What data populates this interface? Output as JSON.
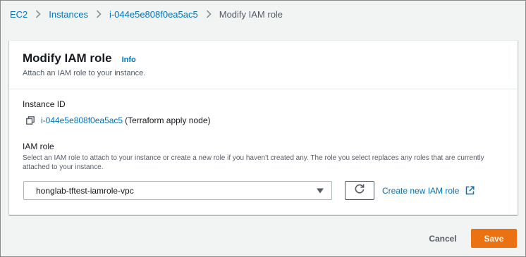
{
  "breadcrumb": {
    "items": [
      {
        "label": "EC2"
      },
      {
        "label": "Instances"
      },
      {
        "label": "i-044e5e808f0ea5ac5"
      },
      {
        "label": "Modify IAM role"
      }
    ]
  },
  "card": {
    "title": "Modify IAM role",
    "info_label": "Info",
    "description": "Attach an IAM role to your instance.",
    "instance_id_label": "Instance ID",
    "instance_id": "i-044e5e808f0ea5ac5",
    "instance_name": "(Terraform apply node)",
    "iam_role_label": "IAM role",
    "iam_role_description": "Select an IAM role to attach to your instance or create a new role if you haven't created any. The role you select replaces any roles that are currently attached to your instance.",
    "selected_role": "honglab-tftest-iamrole-vpc",
    "create_role_label": "Create new IAM role"
  },
  "actions": {
    "cancel_label": "Cancel",
    "save_label": "Save"
  },
  "colors": {
    "link": "#0073bb",
    "primary_button": "#ec7211",
    "background": "#f2f3f3"
  },
  "icons": [
    "chevron-right-icon",
    "copy-icon",
    "caret-down-icon",
    "refresh-icon",
    "external-link-icon"
  ]
}
